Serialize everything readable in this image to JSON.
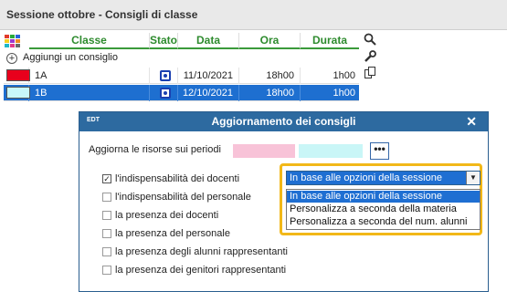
{
  "window": {
    "title": "Sessione ottobre - Consigli di classe"
  },
  "grid": {
    "headers": {
      "classe": "Classe",
      "stato": "Stato",
      "data": "Data",
      "ora": "Ora",
      "durata": "Durata"
    },
    "add_label": "Aggiungi un consiglio",
    "rows": [
      {
        "color": "#e8001c",
        "classe": "1A",
        "data": "11/10/2021",
        "ora": "18h00",
        "durata": "1h00"
      },
      {
        "color": "#c8f7fa",
        "classe": "1B",
        "data": "12/10/2021",
        "ora": "18h00",
        "durata": "1h00"
      }
    ]
  },
  "tools": {
    "search": "search-icon",
    "wrench": "wrench-icon",
    "copy": "copy-icon"
  },
  "modal": {
    "brand": "EDT",
    "title": "Aggiornamento dei consigli",
    "periods_label": "Aggiorna le risorse sui periodi",
    "dots": "•••",
    "period_colors": [
      "#f8c3d8",
      "#c9f6f7"
    ],
    "options": [
      {
        "label": "l'indispensabilità dei docenti",
        "checked": true
      },
      {
        "label": "l'indispensabilità del personale",
        "checked": false
      },
      {
        "label": "la presenza dei docenti",
        "checked": false
      },
      {
        "label": "la presenza del personale",
        "checked": false
      },
      {
        "label": "la presenza degli alunni rappresentanti",
        "checked": false
      },
      {
        "label": "la presenza dei genitori rappresentanti",
        "checked": false
      }
    ],
    "dropdown": {
      "selected": "In base alle opzioni della sessione",
      "options": [
        "In base alle opzioni della sessione",
        "Personalizza a seconda della materia",
        "Personalizza a seconda del num. alunni"
      ],
      "highlight_color": "#f2b818"
    }
  }
}
